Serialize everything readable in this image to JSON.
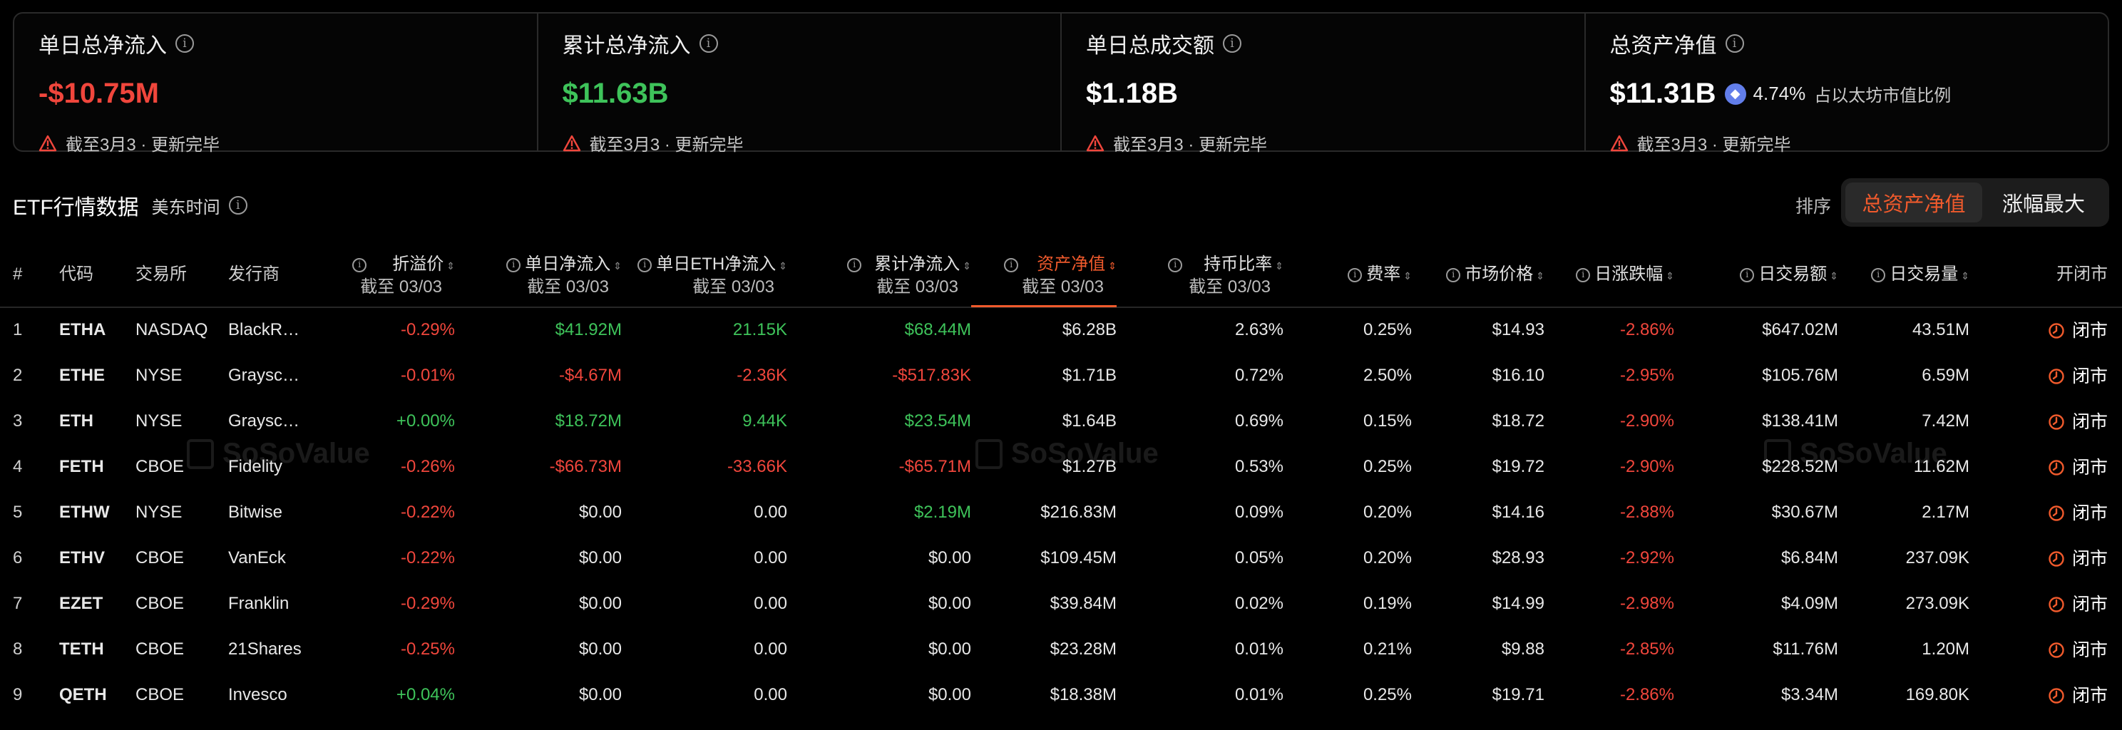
{
  "cards": [
    {
      "title": "单日总净流入",
      "value": "-$10.75M",
      "note": "截至3月3 · 更新完毕"
    },
    {
      "title": "累计总净流入",
      "value": "$11.63B",
      "note": "截至3月3 · 更新完毕"
    },
    {
      "title": "单日总成交额",
      "value": "$1.18B",
      "note": "截至3月3 · 更新完毕"
    },
    {
      "title": "总资产净值",
      "value": "$11.31B",
      "eth_pct": "4.74%",
      "eth_label": "占以太坊市值比例",
      "note": "截至3月3 · 更新完毕"
    }
  ],
  "section": {
    "title": "ETF行情数据",
    "subtitle": "美东时间"
  },
  "sort": {
    "label": "排序",
    "active": "总资产净值",
    "inactive": "涨幅最大"
  },
  "columns": {
    "num": "#",
    "code": "代码",
    "exchange": "交易所",
    "issuer": "发行商",
    "premium": "折溢价",
    "daily_inflow": "单日净流入",
    "daily_eth_inflow": "单日ETH净流入",
    "cum_inflow": "累计净流入",
    "nav": "资产净值",
    "hold_ratio": "持币比率",
    "fee": "费率",
    "price": "市场价格",
    "change": "日涨跌幅",
    "volume_usd": "日交易额",
    "volume": "日交易量",
    "status": "开闭市",
    "as_of": "截至 03/03"
  },
  "rows": [
    {
      "num": "1",
      "code": "ETHA",
      "exchange": "NASDAQ",
      "issuer": "BlackR…",
      "premium": "-0.29%",
      "daily_inflow": "$41.92M",
      "daily_eth_inflow": "21.15K",
      "cum_inflow": "$68.44M",
      "nav": "$6.28B",
      "hold_ratio": "2.63%",
      "fee": "0.25%",
      "price": "$14.93",
      "change": "-2.86%",
      "volume_usd": "$647.02M",
      "volume": "43.51M",
      "status": "闭市"
    },
    {
      "num": "2",
      "code": "ETHE",
      "exchange": "NYSE",
      "issuer": "Graysc…",
      "premium": "-0.01%",
      "daily_inflow": "-$4.67M",
      "daily_eth_inflow": "-2.36K",
      "cum_inflow": "-$517.83K",
      "nav": "$1.71B",
      "hold_ratio": "0.72%",
      "fee": "2.50%",
      "price": "$16.10",
      "change": "-2.95%",
      "volume_usd": "$105.76M",
      "volume": "6.59M",
      "status": "闭市"
    },
    {
      "num": "3",
      "code": "ETH",
      "exchange": "NYSE",
      "issuer": "Graysc…",
      "premium": "+0.00%",
      "daily_inflow": "$18.72M",
      "daily_eth_inflow": "9.44K",
      "cum_inflow": "$23.54M",
      "nav": "$1.64B",
      "hold_ratio": "0.69%",
      "fee": "0.15%",
      "price": "$18.72",
      "change": "-2.90%",
      "volume_usd": "$138.41M",
      "volume": "7.42M",
      "status": "闭市"
    },
    {
      "num": "4",
      "code": "FETH",
      "exchange": "CBOE",
      "issuer": "Fidelity",
      "premium": "-0.26%",
      "daily_inflow": "-$66.73M",
      "daily_eth_inflow": "-33.66K",
      "cum_inflow": "-$65.71M",
      "nav": "$1.27B",
      "hold_ratio": "0.53%",
      "fee": "0.25%",
      "price": "$19.72",
      "change": "-2.90%",
      "volume_usd": "$228.52M",
      "volume": "11.62M",
      "status": "闭市"
    },
    {
      "num": "5",
      "code": "ETHW",
      "exchange": "NYSE",
      "issuer": "Bitwise",
      "premium": "-0.22%",
      "daily_inflow": "$0.00",
      "daily_eth_inflow": "0.00",
      "cum_inflow": "$2.19M",
      "nav": "$216.83M",
      "hold_ratio": "0.09%",
      "fee": "0.20%",
      "price": "$14.16",
      "change": "-2.88%",
      "volume_usd": "$30.67M",
      "volume": "2.17M",
      "status": "闭市"
    },
    {
      "num": "6",
      "code": "ETHV",
      "exchange": "CBOE",
      "issuer": "VanEck",
      "premium": "-0.22%",
      "daily_inflow": "$0.00",
      "daily_eth_inflow": "0.00",
      "cum_inflow": "$0.00",
      "nav": "$109.45M",
      "hold_ratio": "0.05%",
      "fee": "0.20%",
      "price": "$28.93",
      "change": "-2.92%",
      "volume_usd": "$6.84M",
      "volume": "237.09K",
      "status": "闭市"
    },
    {
      "num": "7",
      "code": "EZET",
      "exchange": "CBOE",
      "issuer": "Franklin",
      "premium": "-0.29%",
      "daily_inflow": "$0.00",
      "daily_eth_inflow": "0.00",
      "cum_inflow": "$0.00",
      "nav": "$39.84M",
      "hold_ratio": "0.02%",
      "fee": "0.19%",
      "price": "$14.99",
      "change": "-2.98%",
      "volume_usd": "$4.09M",
      "volume": "273.09K",
      "status": "闭市"
    },
    {
      "num": "8",
      "code": "TETH",
      "exchange": "CBOE",
      "issuer": "21Shares",
      "premium": "-0.25%",
      "daily_inflow": "$0.00",
      "daily_eth_inflow": "0.00",
      "cum_inflow": "$0.00",
      "nav": "$23.28M",
      "hold_ratio": "0.01%",
      "fee": "0.21%",
      "price": "$9.88",
      "change": "-2.85%",
      "volume_usd": "$11.76M",
      "volume": "1.20M",
      "status": "闭市"
    },
    {
      "num": "9",
      "code": "QETH",
      "exchange": "CBOE",
      "issuer": "Invesco",
      "premium": "+0.04%",
      "daily_inflow": "$0.00",
      "daily_eth_inflow": "0.00",
      "cum_inflow": "$0.00",
      "nav": "$18.38M",
      "hold_ratio": "0.01%",
      "fee": "0.25%",
      "price": "$19.71",
      "change": "-2.86%",
      "volume_usd": "$3.34M",
      "volume": "169.80K",
      "status": "闭市"
    }
  ],
  "watermark": "SoSoValue",
  "colors": {
    "positive": "#3ec35a",
    "negative": "#f0463c",
    "accent": "#f05a2c",
    "eth": "#627eea"
  }
}
